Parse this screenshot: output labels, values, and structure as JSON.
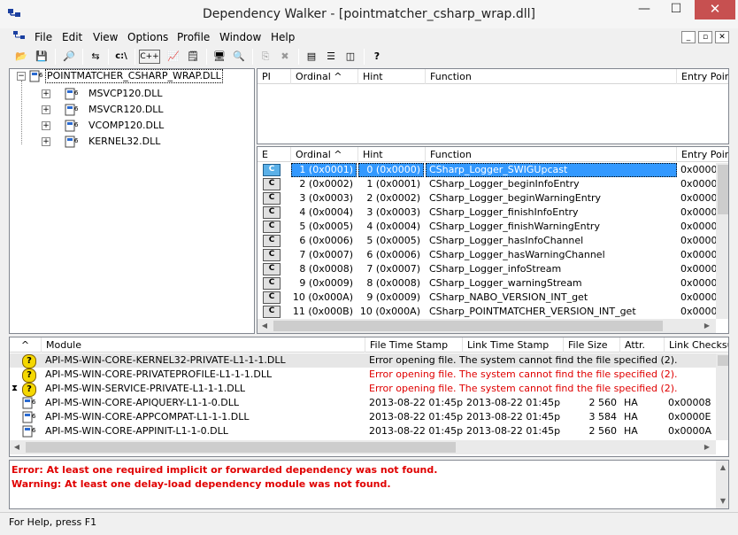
{
  "window": {
    "title": "Dependency Walker - [pointmatcher_csharp_wrap.dll]",
    "close_glyph": "✕",
    "minimize_glyph": "—",
    "maximize_glyph": "☐"
  },
  "menu": {
    "items": [
      "File",
      "Edit",
      "View",
      "Options",
      "Profile",
      "Window",
      "Help"
    ],
    "mdi_buttons": [
      "_",
      "▫",
      "✕"
    ]
  },
  "toolbar": {
    "buttons": [
      {
        "icon": "open-folder-icon",
        "glyph": "📂"
      },
      {
        "icon": "save-icon",
        "glyph": "💾"
      },
      {
        "icon": "find-icon",
        "glyph": "🔎"
      },
      {
        "icon": "full-paths-icon",
        "glyph": "⇆"
      },
      {
        "icon": "c-path-icon",
        "label": "c:\\"
      },
      {
        "icon": "cpp-undecorate-icon",
        "label": "C++"
      },
      {
        "icon": "chart-icon",
        "glyph": "📈"
      },
      {
        "icon": "properties-icon",
        "glyph": "🗒"
      },
      {
        "icon": "system-info-icon",
        "glyph": "🖥"
      },
      {
        "icon": "view-module-icon",
        "glyph": "🔍"
      },
      {
        "icon": "copy-icon",
        "glyph": "⎘"
      },
      {
        "icon": "stop-icon",
        "glyph": "✖"
      },
      {
        "icon": "cascade-icon",
        "glyph": "▤"
      },
      {
        "icon": "tile-horizontal-icon",
        "glyph": "☰"
      },
      {
        "icon": "tile-vertical-icon",
        "glyph": "◫"
      },
      {
        "icon": "context-help-icon",
        "glyph": "?"
      }
    ]
  },
  "tree": {
    "root": "POINTMATCHER_CSHARP_WRAP.DLL",
    "children": [
      "MSVCP120.DLL",
      "MSVCR120.DLL",
      "VCOMP120.DLL",
      "KERNEL32.DLL"
    ]
  },
  "imports_pane": {
    "headers": [
      "PI",
      "Ordinal ^",
      "Hint",
      "Function",
      "Entry Point"
    ]
  },
  "exports_pane": {
    "headers": [
      "E",
      "Ordinal ^",
      "Hint",
      "Function",
      "Entry Point"
    ],
    "rows": [
      {
        "ordinal": "1 (0x0001)",
        "hint": "0 (0x0000)",
        "function": "CSharp_Logger_SWIGUpcast",
        "entry": "0x0000"
      },
      {
        "ordinal": "2 (0x0002)",
        "hint": "1 (0x0001)",
        "function": "CSharp_Logger_beginInfoEntry",
        "entry": "0x0000"
      },
      {
        "ordinal": "3 (0x0003)",
        "hint": "2 (0x0002)",
        "function": "CSharp_Logger_beginWarningEntry",
        "entry": "0x0000"
      },
      {
        "ordinal": "4 (0x0004)",
        "hint": "3 (0x0003)",
        "function": "CSharp_Logger_finishInfoEntry",
        "entry": "0x0000"
      },
      {
        "ordinal": "5 (0x0005)",
        "hint": "4 (0x0004)",
        "function": "CSharp_Logger_finishWarningEntry",
        "entry": "0x0000"
      },
      {
        "ordinal": "6 (0x0006)",
        "hint": "5 (0x0005)",
        "function": "CSharp_Logger_hasInfoChannel",
        "entry": "0x0000"
      },
      {
        "ordinal": "7 (0x0007)",
        "hint": "6 (0x0006)",
        "function": "CSharp_Logger_hasWarningChannel",
        "entry": "0x0000"
      },
      {
        "ordinal": "8 (0x0008)",
        "hint": "7 (0x0007)",
        "function": "CSharp_Logger_infoStream",
        "entry": "0x0000"
      },
      {
        "ordinal": "9 (0x0009)",
        "hint": "8 (0x0008)",
        "function": "CSharp_Logger_warningStream",
        "entry": "0x0000"
      },
      {
        "ordinal": "10 (0x000A)",
        "hint": "9 (0x0009)",
        "function": "CSharp_NABO_VERSION_INT_get",
        "entry": "0x0000"
      },
      {
        "ordinal": "11 (0x000B)",
        "hint": "10 (0x000A)",
        "function": "CSharp_POINTMATCHER_VERSION_INT_get",
        "entry": "0x0000"
      }
    ],
    "badge": "C"
  },
  "modules_pane": {
    "headers": [
      "^",
      "Module",
      "File Time Stamp",
      "Link Time Stamp",
      "File Size",
      "Attr.",
      "Link Checksum"
    ],
    "rows": [
      {
        "icon": "question",
        "module": "API-MS-WIN-CORE-KERNEL32-PRIVATE-L1-1-1.DLL",
        "error": "Error opening file. The system cannot find the file specified (2).",
        "highlight": true
      },
      {
        "icon": "question",
        "module": "API-MS-WIN-CORE-PRIVATEPROFILE-L1-1-1.DLL",
        "error": "Error opening file. The system cannot find the file specified (2).",
        "red": true
      },
      {
        "icon": "hourglass-question",
        "module": "API-MS-WIN-SERVICE-PRIVATE-L1-1-1.DLL",
        "error": "Error opening file. The system cannot find the file specified (2).",
        "red": true
      },
      {
        "icon": "module",
        "module": "API-MS-WIN-CORE-APIQUERY-L1-1-0.DLL",
        "file_ts": "2013-08-22 01:45p",
        "link_ts": "2013-08-22 01:45p",
        "size": "2 560",
        "attr": "HA",
        "checksum": "0x00008"
      },
      {
        "icon": "module",
        "module": "API-MS-WIN-CORE-APPCOMPAT-L1-1-1.DLL",
        "file_ts": "2013-08-22 01:45p",
        "link_ts": "2013-08-22 01:45p",
        "size": "3 584",
        "attr": "HA",
        "checksum": "0x0000E"
      },
      {
        "icon": "module",
        "module": "API-MS-WIN-CORE-APPINIT-L1-1-0.DLL",
        "file_ts": "2013-08-22 01:45p",
        "link_ts": "2013-08-22 01:45p",
        "size": "2 560",
        "attr": "HA",
        "checksum": "0x0000A"
      }
    ]
  },
  "log": {
    "lines": [
      "Error: At least one required implicit or forwarded dependency was not found.",
      "Warning: At least one delay-load dependency module was not found."
    ]
  },
  "status": {
    "text": "For Help, press F1"
  },
  "colors": {
    "selection": "#3399ff",
    "error": "#e00000",
    "close": "#c75050"
  }
}
